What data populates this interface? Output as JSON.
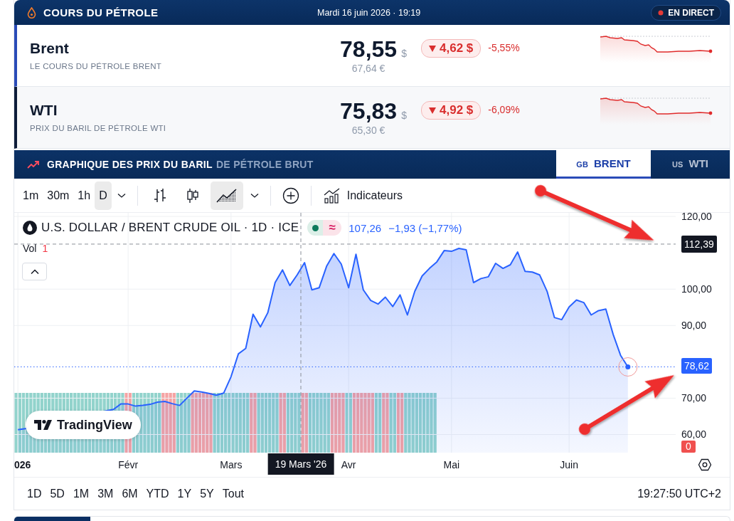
{
  "header": {
    "title": "COURS DU PÉTROLE",
    "datetime": "Mardi 16 juin 2026 · 19:19",
    "live_badge": "EN DIRECT"
  },
  "quotes": [
    {
      "name": "Brent",
      "subtitle": "LE COURS DU PÉTROLE BRENT",
      "price": "78,55",
      "currency": "$",
      "price_eur": "67,64 €",
      "change": "4,62 $",
      "falling": true,
      "change_pct": "-5,55%",
      "selected": true
    },
    {
      "name": "WTI",
      "subtitle": "PRIX DU BARIL DE PÉTROLE WTI",
      "price": "75,83",
      "currency": "$",
      "price_eur": "65,30 €",
      "change": "4,92 $",
      "falling": true,
      "change_pct": "-6,09%",
      "selected": false
    }
  ],
  "chart_section": {
    "title": "GRAPHIQUE DES PRIX DU BARIL",
    "title_suffix": "DE PÉTROLE BRUT",
    "tabs": [
      {
        "flag": "GB",
        "label": "BRENT",
        "selected": true
      },
      {
        "flag": "US",
        "label": "WTI",
        "selected": false
      }
    ]
  },
  "toolbar": {
    "intervals": [
      {
        "label": "1m",
        "selected": false
      },
      {
        "label": "30m",
        "selected": false
      },
      {
        "label": "1h",
        "selected": false
      },
      {
        "label": "D",
        "selected": true
      }
    ],
    "chart_types": [
      {
        "kind": "bars",
        "selected": false
      },
      {
        "kind": "candles",
        "selected": false
      },
      {
        "kind": "area",
        "selected": true
      }
    ],
    "indicators_label": "Indicateurs"
  },
  "chart": {
    "crosshair_date_label": "19 Mars '26",
    "status_symbol": "≈",
    "last_value": "107,26",
    "last_change": "−1,93 (−1,77%)",
    "volume_label": "Vol",
    "volume_value": "1",
    "volume_axis_label": "0",
    "logo": "TradingView",
    "chart_data": {
      "type": "area",
      "categories": [
        "026",
        null,
        null,
        null,
        null,
        null,
        null,
        null,
        null,
        null,
        null,
        null,
        null,
        null,
        null,
        "Févr",
        null,
        null,
        null,
        null,
        null,
        null,
        null,
        null,
        null,
        null,
        null,
        null,
        null,
        "Mars",
        null,
        null,
        null,
        null,
        null,
        null,
        null,
        null,
        null,
        null,
        null,
        null,
        null,
        null,
        null,
        "Avr",
        null,
        null,
        null,
        null,
        null,
        null,
        null,
        null,
        null,
        null,
        null,
        null,
        null,
        "Mai",
        null,
        null,
        null,
        null,
        null,
        null,
        null,
        null,
        null,
        null,
        null,
        null,
        null,
        null,
        null,
        "Juin",
        null,
        null,
        null,
        null,
        null,
        null,
        null,
        null
      ],
      "grid": true,
      "series": [
        {
          "name": "U.S. DOLLAR / BRENT CRUDE OIL · 1D · ICE",
          "color": "#2962ff",
          "values": [
            61.3,
            61.6,
            null,
            null,
            null,
            null,
            null,
            null,
            null,
            null,
            null,
            null,
            66.5,
            66.9,
            68.4,
            68.4,
            67.8,
            68.0,
            68.3,
            68.9,
            69.1,
            68.5,
            68.0,
            70.0,
            72.0,
            71.7,
            71.3,
            70.8,
            71.4,
            75.9,
            82.2,
            83.7,
            93.1,
            89.6,
            93.5,
            101.8,
            105.3,
            101.0,
            103.9,
            107.3,
            99.8,
            100.4,
            106.3,
            109.8,
            106.9,
            100.4,
            109.6,
            99.8,
            96.9,
            95.9,
            97.8,
            95.2,
            98.4,
            92.9,
            99.4,
            103.6,
            105.7,
            107.5,
            110.6,
            110.4,
            111.2,
            110.8,
            101.8,
            102.9,
            103.4,
            107.1,
            105.7,
            106.7,
            110.2,
            104.9,
            104.7,
            103.9,
            99.4,
            92.2,
            91.6,
            95.1,
            97.0,
            96.3,
            92.9,
            94.1,
            94.5,
            87.5,
            81.8,
            78.6
          ]
        }
      ],
      "ylim": [
        55,
        121
      ],
      "yticks": [
        {
          "value": 60,
          "label": "60,00"
        },
        {
          "value": 70,
          "label": "70,00"
        },
        {
          "value": 90,
          "label": "90,00"
        },
        {
          "value": 100,
          "label": "100,00"
        },
        {
          "value": 120,
          "label": "120,00"
        }
      ],
      "ref_lines": [
        {
          "axis": "y",
          "value": 112.39,
          "label": "112,39"
        },
        {
          "axis": "y",
          "value": 78.62,
          "label": "78,62"
        }
      ]
    }
  },
  "range_buttons": [
    "1D",
    "5D",
    "1M",
    "3M",
    "6M",
    "YTD",
    "1Y",
    "5Y",
    "Tout"
  ],
  "clock": "19:27:50 UTC+2"
}
